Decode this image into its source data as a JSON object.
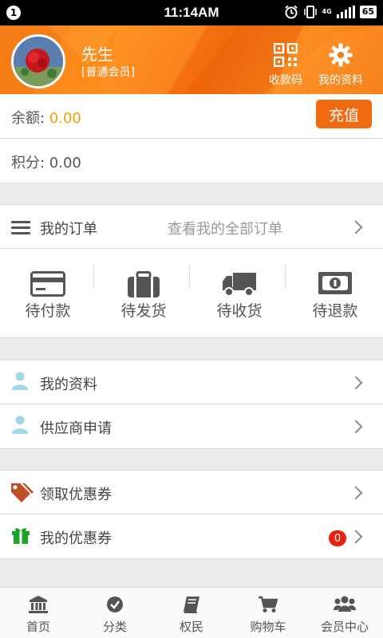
{
  "status_bar": {
    "notification_count": "1",
    "time": "11:14AM",
    "network": "4G",
    "battery": "65"
  },
  "header": {
    "user_name": "先生",
    "member_level": "[普通会员]",
    "qr_label": "收款码",
    "profile_label": "我的资料"
  },
  "wallet": {
    "balance_label": "余额: ",
    "balance_value": "0.00",
    "recharge_label": "充值",
    "points_text": "积分: 0.00"
  },
  "orders": {
    "title": "我的订单",
    "view_all": "查看我的全部订单",
    "statuses": [
      {
        "label": "待付款",
        "icon": "card-icon"
      },
      {
        "label": "待发货",
        "icon": "briefcase-icon"
      },
      {
        "label": "待收货",
        "icon": "truck-icon"
      },
      {
        "label": "待退款",
        "icon": "money-icon"
      }
    ]
  },
  "account_menu": [
    {
      "label": "我的资料",
      "icon": "user-icon"
    },
    {
      "label": "供应商申请",
      "icon": "user-icon"
    }
  ],
  "coupon_menu": [
    {
      "label": "领取优惠券",
      "icon": "tags-icon"
    },
    {
      "label": "我的优惠券",
      "icon": "gift-icon",
      "badge": "0"
    }
  ],
  "tabbar": [
    {
      "label": "首页",
      "icon": "bank-icon"
    },
    {
      "label": "分类",
      "icon": "check-circle-icon"
    },
    {
      "label": "权民",
      "icon": "book-icon"
    },
    {
      "label": "购物车",
      "icon": "cart-icon"
    },
    {
      "label": "会员中心",
      "icon": "users-icon"
    }
  ],
  "colors": {
    "accent": "#f26a10",
    "balance": "#f5a000",
    "badge": "#e8210d",
    "user_icon": "#9fd8e6"
  }
}
